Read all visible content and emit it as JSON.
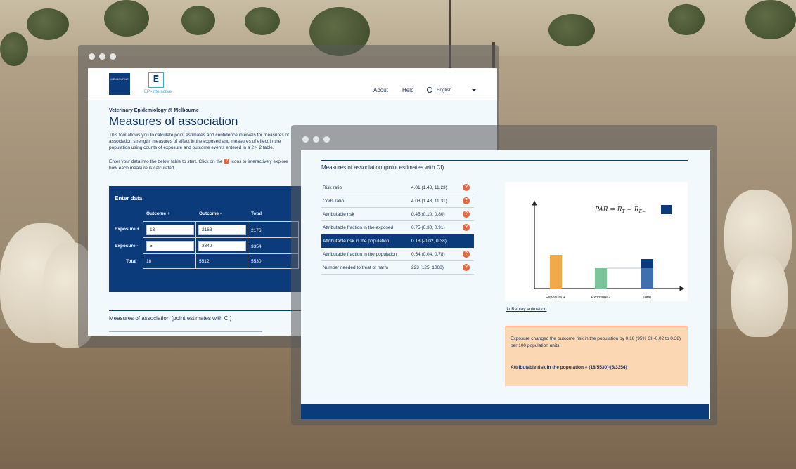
{
  "back_window": {
    "nav": {
      "about": "About",
      "help": "Help",
      "language": "English"
    },
    "logo": {
      "university_text": "MELBOURNE",
      "epi_letter": "E",
      "epi_text": "EPI-interactive"
    },
    "kicker": "Veterinary Epidemiology @ Melbourne",
    "title": "Measures of association",
    "intro": "This tool allows you to calculate point estimates and confidence intervals for measures of association strength, measures of effect in the exposed and measures of effect in the population using counts of exposure and outcome events entered in a 2 × 2 table.",
    "instruction_a": "Enter your data into the below table to start. Click on the",
    "instruction_b": "icons to interactively explore how each measure is calculated.",
    "enter_data": {
      "title": "Enter data",
      "headers": [
        "Outcome +",
        "Outcome -",
        "Total"
      ],
      "rows": [
        {
          "label": "Exposure +",
          "a": "13",
          "b": "2163",
          "total": "2176"
        },
        {
          "label": "Exposure -",
          "a": "5",
          "b": "3349",
          "total": "3354"
        },
        {
          "label": "Total",
          "a": "18",
          "b": "5512",
          "total": "5530"
        }
      ]
    },
    "section_title": "Measures of association (point estimates with CI)"
  },
  "front_window": {
    "title": "Measures of association (point estimates with CI)",
    "measures": [
      {
        "label": "Risk ratio",
        "value": "4.01 (1.43, 11.23)"
      },
      {
        "label": "Odds ratio",
        "value": "4.03 (1.43, 11.31)"
      },
      {
        "label": "Attributable risk",
        "value": "0.45 (0.10, 0.80)"
      },
      {
        "label": "Attributable fraction in the exposed",
        "value": "0.75 (0.30, 0.91)"
      },
      {
        "label": "Attributable risk in the population",
        "value": "0.18 (-0.02, 0.38)"
      },
      {
        "label": "Attributable fraction in the population",
        "value": "0.54 (0.04, 0.78)"
      },
      {
        "label": "Number needed to treat or harm",
        "value": "223 (125, 1008)"
      }
    ],
    "selected_index": 4,
    "help_glyph": "?",
    "chart": {
      "formula": "PAR = R",
      "formula_sub1": "T",
      "formula_mid": " − R",
      "formula_sub2": "E−",
      "x_labels": [
        "Exposure +",
        "Exposure -",
        "Total"
      ],
      "colors": {
        "exposed": "#f2a94a",
        "unexposed": "#7cc49a",
        "total": "#0b3b7a",
        "total_light": "#3e6fae"
      }
    },
    "replay_label": "Replay animation",
    "info_text": "Exposure changed the outcome risk in the population by 0.18 (95% CI -0.02 to 0.38) per 100 population units.",
    "info_formula": "Attributable risk in the population = (18/5530)-(5/3354)"
  }
}
